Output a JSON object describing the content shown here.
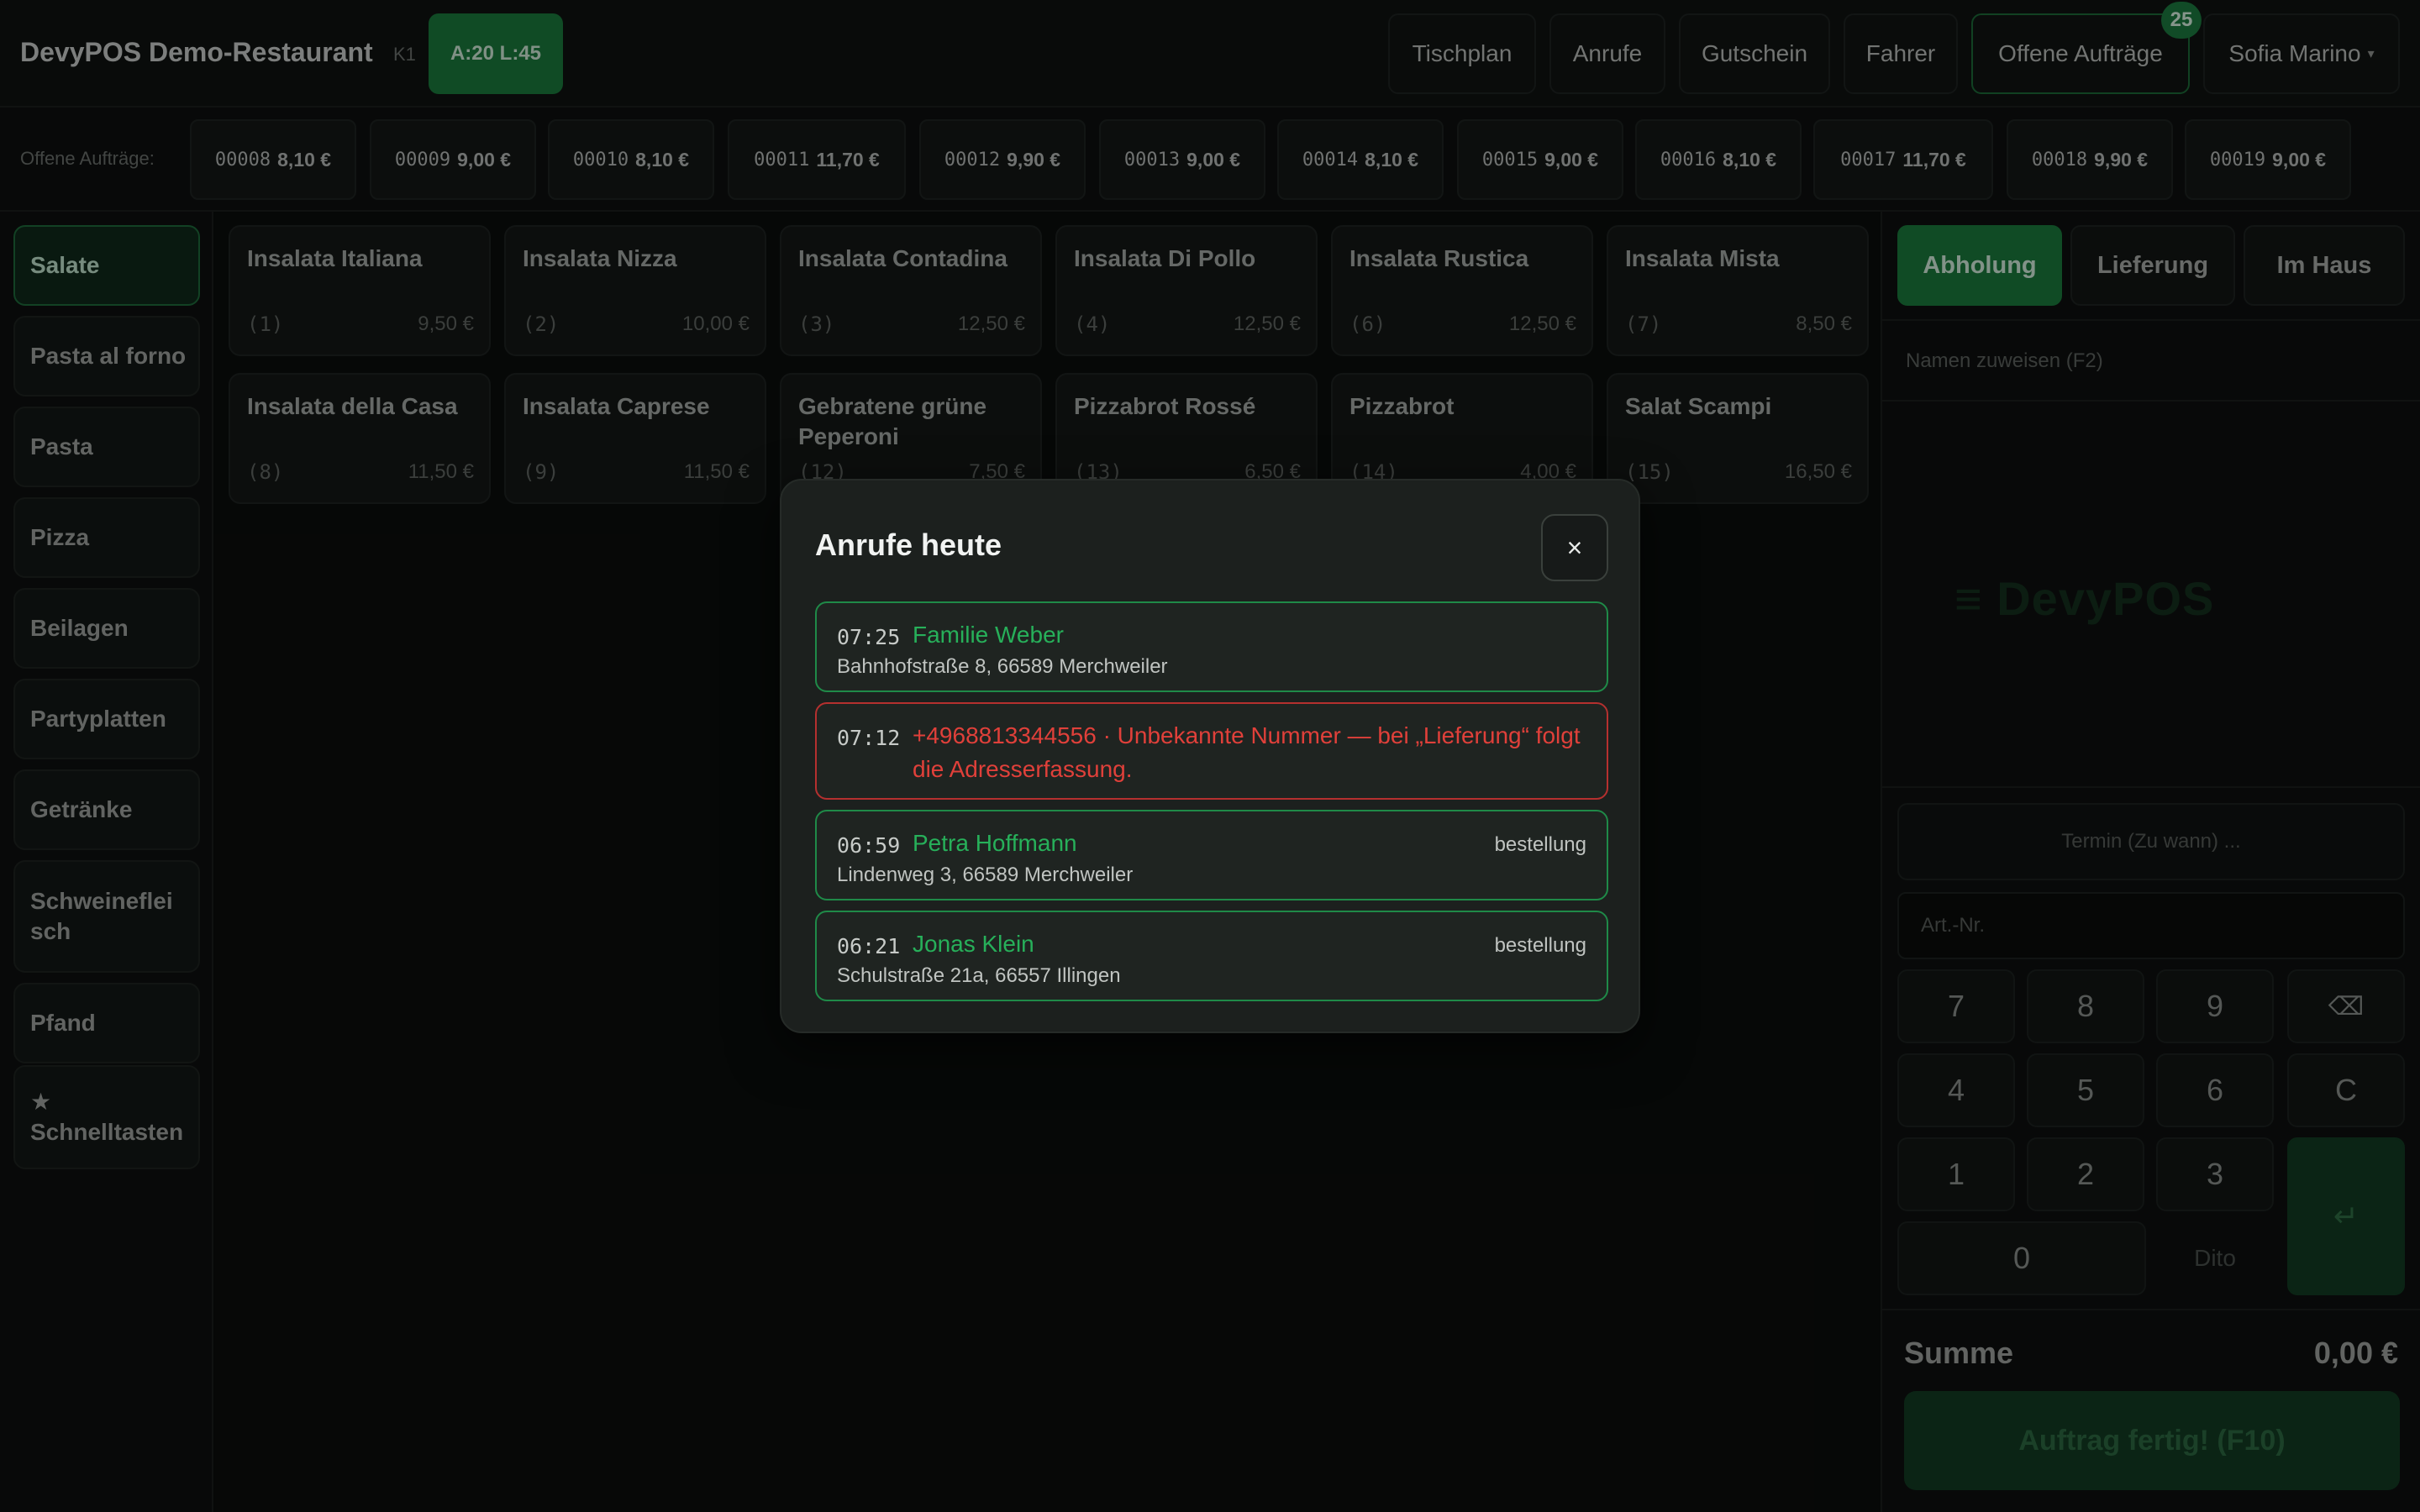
{
  "header": {
    "brand": "DevyPOS Demo-Restaurant",
    "terminal": "K1",
    "stats": "A:20 L:45",
    "nav": [
      "Tischplan",
      "Anrufe",
      "Gutschein",
      "Fahrer",
      "Offene Aufträge"
    ],
    "open_orders_count": "25",
    "user": "Sofia Marino",
    "user_caret": "▾"
  },
  "orders": {
    "label": "Offene Aufträge:",
    "items": [
      {
        "id": "00008",
        "amount": "8,10 €"
      },
      {
        "id": "00009",
        "amount": "9,00 €"
      },
      {
        "id": "00010",
        "amount": "8,10 €"
      },
      {
        "id": "00011",
        "amount": "11,70 €"
      },
      {
        "id": "00012",
        "amount": "9,90 €"
      },
      {
        "id": "00013",
        "amount": "9,00 €"
      },
      {
        "id": "00014",
        "amount": "8,10 €"
      },
      {
        "id": "00015",
        "amount": "9,00 €"
      },
      {
        "id": "00016",
        "amount": "8,10 €"
      },
      {
        "id": "00017",
        "amount": "11,70 €"
      },
      {
        "id": "00018",
        "amount": "9,90 €"
      },
      {
        "id": "00019",
        "amount": "9,00 €"
      }
    ]
  },
  "categories": {
    "items": [
      "Salate",
      "Pasta al forno",
      "Pasta",
      "Pizza",
      "Beilagen",
      "Partyplatten",
      "Getränke",
      "Schweinefleisch",
      "Pfand",
      "Schnelltasten"
    ],
    "star_icon": "★",
    "active": "Salate"
  },
  "products": [
    {
      "name": "Insalata Italiana",
      "nr": "(1)",
      "price": "9,50 €"
    },
    {
      "name": "Insalata Nizza",
      "nr": "(2)",
      "price": "10,00 €"
    },
    {
      "name": "Insalata Contadina",
      "nr": "(3)",
      "price": "12,50 €"
    },
    {
      "name": "Insalata Di Pollo",
      "nr": "(4)",
      "price": "12,50 €"
    },
    {
      "name": "Insalata Rustica",
      "nr": "(6)",
      "price": "12,50 €"
    },
    {
      "name": "Insalata Mista",
      "nr": "(7)",
      "price": "8,50 €"
    },
    {
      "name": "Insalata della Casa",
      "nr": "(8)",
      "price": "11,50 €"
    },
    {
      "name": "Insalata Caprese",
      "nr": "(9)",
      "price": "11,50 €"
    },
    {
      "name": "Gebratene grüne Peperoni",
      "nr": "(12)",
      "price": "7,50 €"
    },
    {
      "name": "Pizzabrot Rossé",
      "nr": "(13)",
      "price": "6,50 €"
    },
    {
      "name": "Pizzabrot",
      "nr": "(14)",
      "price": "4,00 €"
    },
    {
      "name": "Salat Scampi",
      "nr": "(15)",
      "price": "16,50 €"
    }
  ],
  "order_panel": {
    "modes": [
      "Abholung",
      "Lieferung",
      "Im Haus"
    ],
    "active_mode": "Abholung",
    "name_assign": "Namen zuweisen (F2)",
    "logo": "≡ DevyPOS",
    "termin_placeholder": "Termin (Zu wann) ...",
    "artnr_placeholder": "Art.-Nr.",
    "keys": [
      "7",
      "8",
      "9",
      "⌫",
      "4",
      "5",
      "6",
      "C",
      "1",
      "2",
      "3",
      "0",
      "Dito",
      "↵"
    ],
    "sum_label": "Summe",
    "sum_value": "0,00 €",
    "finish": "Auftrag fertig! (F10)"
  },
  "modal": {
    "title": "Anrufe heute",
    "close": "×",
    "calls": [
      {
        "time": "07:25",
        "name": "Familie Weber",
        "address": "Bahnhofstraße 8, 66589 Merchweiler",
        "tag": ""
      },
      {
        "time": "07:12",
        "warning": "+4968813344556 · Unbekannte Nummer — bei „Lieferung“ folgt die Adresserfassung."
      },
      {
        "time": "06:59",
        "name": "Petra Hoffmann",
        "address": "Lindenweg 3, 66589 Merchweiler",
        "tag": "bestellung"
      },
      {
        "time": "06:21",
        "name": "Jonas Klein",
        "address": "Schulstraße 21a, 66557 Illingen",
        "tag": "bestellung"
      }
    ]
  },
  "colors": {
    "accent": "#1b7a3d",
    "background": "#0b0d0c",
    "modal": "#1c201e",
    "call_border": "#1f8a48",
    "warning": "#e0403a"
  }
}
